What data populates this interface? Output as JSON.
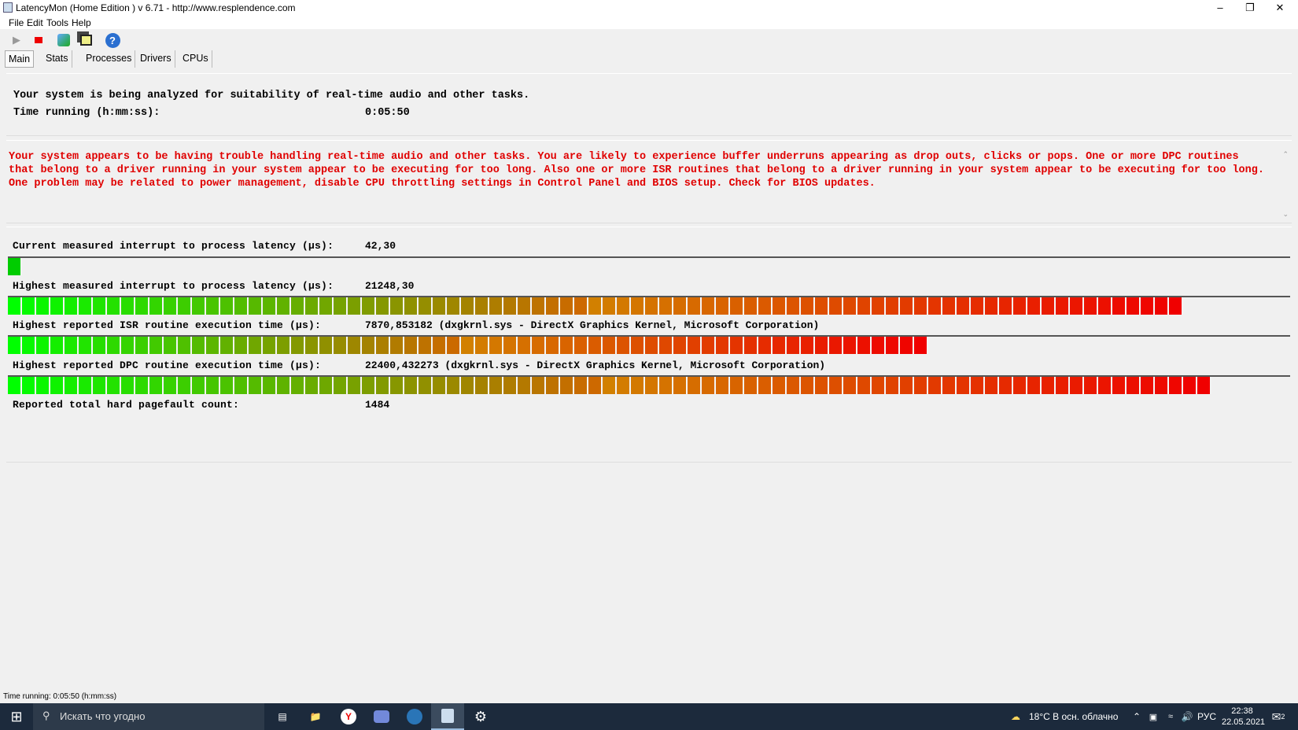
{
  "window": {
    "title": "LatencyMon  (Home Edition )  v 6.71 - http://www.resplendence.com"
  },
  "menu": [
    "File",
    "Edit",
    "Tools",
    "Help"
  ],
  "tabs": [
    "Main",
    "Stats",
    "Processes",
    "Drivers",
    "CPUs"
  ],
  "header": {
    "line1": "Your system is being analyzed for suitability of real-time audio and other tasks.",
    "time_label": "Time running (h:mm:ss):",
    "time_value": "0:05:50"
  },
  "warning": "Your system appears to be having trouble handling real-time audio and other tasks. You are likely to experience buffer underruns appearing as drop outs, clicks or pops. One or more DPC routines that belong to a driver running in your system appear to be executing for too long. Also one or more ISR routines that belong to a driver running in your system appear to be executing for too long. One problem may be related to power management, disable CPU throttling settings in Control Panel and BIOS setup. Check for BIOS updates.",
  "metrics": [
    {
      "label": "Current measured interrupt to process latency (µs):",
      "value": "42,30",
      "bar_fraction": 0.011
    },
    {
      "label": "Highest measured interrupt to process latency (µs):",
      "value": "21248,30",
      "bar_fraction": 0.918
    },
    {
      "label": "Highest reported ISR routine execution time (µs):",
      "value": "7870,853182  (dxgkrnl.sys - DirectX Graphics Kernel, Microsoft Corporation)",
      "bar_fraction": 0.718
    },
    {
      "label": "Highest reported DPC routine execution time (µs):",
      "value": "22400,432273  (dxgkrnl.sys - DirectX Graphics Kernel, Microsoft Corporation)",
      "bar_fraction": 0.939
    },
    {
      "label": "Reported total hard pagefault count:",
      "value": "1484"
    }
  ],
  "status": "Time running: 0:05:50  (h:mm:ss)",
  "taskbar": {
    "search_placeholder": "Искать что угодно",
    "weather": "18°C  В осн. облачно",
    "lang": "РУС",
    "time": "22:38",
    "date": "22.05.2021",
    "notifications": "2"
  }
}
